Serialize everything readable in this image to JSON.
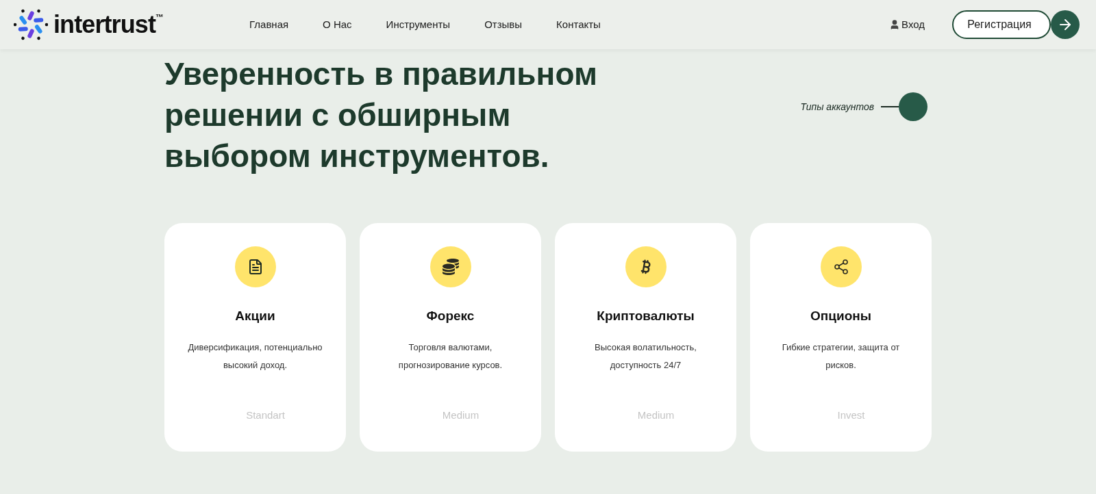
{
  "header": {
    "logo": {
      "name": "intertrust",
      "mark": "™"
    },
    "nav": [
      {
        "label": "Главная"
      },
      {
        "label": "О Нас"
      },
      {
        "label": "Инструменты"
      },
      {
        "label": "Отзывы"
      },
      {
        "label": "Контакты"
      }
    ],
    "login": "Вход",
    "register": "Регистрация"
  },
  "hero": {
    "title": "Уверенность в правильном решении с обширным выбором инструментов.",
    "side_link": "Типы аккаунтов"
  },
  "cards": [
    {
      "title": "Акции",
      "text": "Диверсификация, потенциально высокий доход.",
      "tier": "Standart"
    },
    {
      "title": "Форекс",
      "text": "Торговля валютами, прогнозирование курсов.",
      "tier": "Medium"
    },
    {
      "title": "Криптовалюты",
      "text": "Высокая волатильность, доступность 24/7",
      "tier": "Medium"
    },
    {
      "title": "Опционы",
      "text": "Гибкие стратегии, защита от рисков.",
      "tier": "Invest"
    }
  ]
}
